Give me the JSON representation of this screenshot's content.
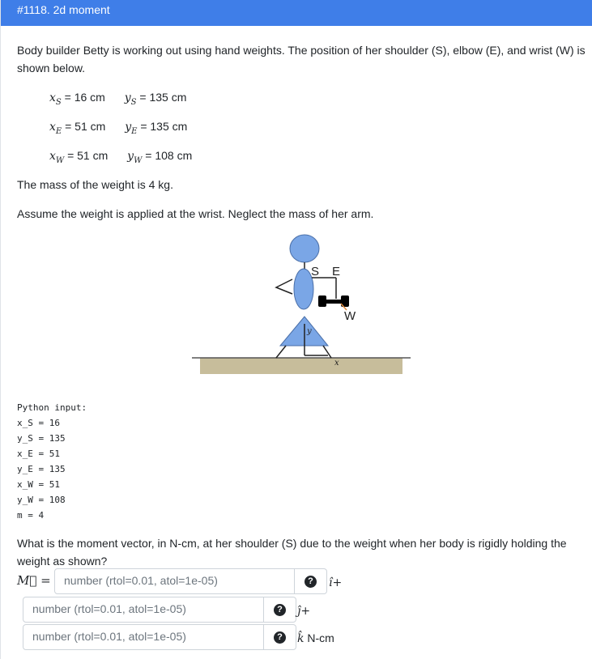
{
  "header": {
    "title": "#1118. 2d moment"
  },
  "intro": "Body builder Betty is working out using hand weights. The position of her shoulder (S), elbow (E), and wrist (W) is shown below.",
  "given": [
    {
      "x_var": "x",
      "x_sub": "S",
      "x_val": " = 16 cm",
      "y_var": "y",
      "y_sub": "S",
      "y_val": " = 135 cm"
    },
    {
      "x_var": "x",
      "x_sub": "E",
      "x_val": " = 51 cm",
      "y_var": "y",
      "y_sub": "E",
      "y_val": " = 135 cm"
    },
    {
      "x_var": "x",
      "x_sub": "W",
      "x_val": " = 51 cm",
      "y_var": "y",
      "y_sub": "W",
      "y_val": " = 108 cm"
    }
  ],
  "mass_text": "The mass of the weight is 4 kg.",
  "assume_text": "Assume the weight is applied at the wrist. Neglect the mass of her arm.",
  "figure": {
    "label_s": "S",
    "label_e": "E",
    "label_w": "W",
    "label_x": "x",
    "label_y": "y",
    "body_color": "#7aa6e6",
    "ground_color": "#c7bd9b",
    "weight_color": "#000000",
    "forearm_color": "#e08a3c"
  },
  "python_input": [
    "Python input:",
    "x_S = 16",
    "y_S = 135",
    "x_E = 51",
    "y_E = 135",
    "x_W = 51",
    "y_W = 108",
    "m = 4"
  ],
  "question": "What is the moment vector, in N-cm, at her shoulder (S) due to the weight when her body is rigidly holding the weight as shown?",
  "answer": {
    "label": "M⃗ =",
    "placeholder": "number (rtol=0.01, atol=1e-05)",
    "help_glyph": "?",
    "i_unit": "î+",
    "j_unit": "ĵ+",
    "k_unit_hat": "k̂",
    "k_unit_text": " N-cm"
  }
}
